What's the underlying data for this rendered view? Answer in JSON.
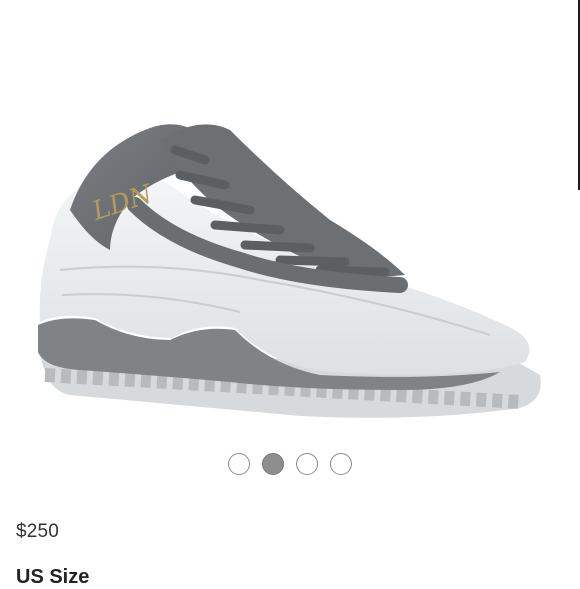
{
  "listing": {
    "brand_text": "LDN",
    "price": "$250",
    "size_label": "US Size"
  },
  "gallery": {
    "image_count": 4,
    "active_index": 1
  },
  "colors": {
    "upper_white": "#e6e9ea",
    "suede_grey": "#6e7174",
    "sole_grey": "#8f9396",
    "dot_active": "#8e8e8e",
    "logo_gold": "#b59a5e"
  }
}
